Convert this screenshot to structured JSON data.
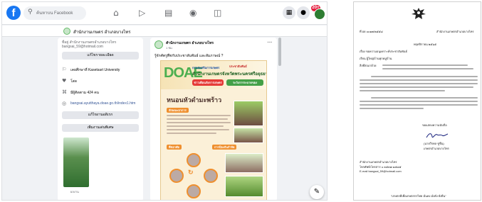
{
  "facebook": {
    "logo_letter": "f",
    "search_placeholder": "ค้นหาบน Facebook",
    "notification_count": "20+",
    "page_header_name": "สำนักงานเกษตร อำเภอบางไทร",
    "intro": {
      "email_line_1": "ที่อยู่ สำนักงานเกษตรอำเภอบางไทร",
      "email_line_2": "bangsai_59@hotmail.com",
      "edit_details_button": "แก้ไขรายละเอียด",
      "education": "เคยศึกษาที่ Kasetsart University",
      "relationship": "โสด",
      "followers": "มีผู้ติดตาม 424 คน",
      "website": "bangsai.ayutthaya.doae.go.th/index1.htm",
      "edit_hobbies_button": "แก้ไขงานอดิเรก",
      "add_featured_button": "เพิ่มงานเด่นพิเศษ",
      "thumb_caption": "ผลงาน"
    },
    "post": {
      "page_name": "สำนักงานเกษตร อำเภอบางไทร",
      "time": "1 ชม.",
      "more": "···",
      "text": "รู้จักศัตรูพืชกับประชาสัมพันธ์ และสัมภาษณ์ ?",
      "poster": {
        "logo_text": "DOAE",
        "tag": "ประชาสัมพันธ์",
        "agency_line": "กรมส่งเสริมการเกษตร",
        "title": "สำนักงานเกษตรจังหวัดพระนครศรีอยุธยา",
        "pill_left": "ข่าวเตือนภัยการเกษตร",
        "pill_right": "ระวังการระบาดของ",
        "headline": "หนอนหัวดำมะพร้าว",
        "label_symptoms": "ลักษณะอาการ",
        "label_fix": "การป้องกันกำจัด",
        "label_host": "พืชอาศัย"
      }
    }
  },
  "letter": {
    "ref_number": "ที่ อย ๐๐๑๗/๒๕๕๔",
    "agency": "สำนักงานเกษตรอำเภอบางไทร",
    "date": "พฤศจิกายน ๒๕๖๕",
    "subject": "เรื่อง ขอความอนุเคราะห์ประชาสัมพันธ์",
    "to": "เรียน ผู้ใหญ่บ้านทุกหมู่บ้าน",
    "attachment": "สิ่งที่ส่งมาด้วย",
    "closing": "ขอแสดงความนับถือ",
    "signer_name": "(นายวีรพล ชูชื่น)",
    "signer_title": "เกษตรอำเภอบางไทร",
    "contact_office": "สำนักงานเกษตรอำเภอบางไทร",
    "contact_phone": "โทรศัพท์/โทรสาร ๐ ๓๕๓๗ ๑๕๘๕",
    "contact_email": "E-mail bangsai_59@hotmail.com",
    "slogan": "\"เกษตรดีเพื่อเกษตรกรไทย มั่นคง มั่งคั่ง ยั่งยืน\""
  }
}
